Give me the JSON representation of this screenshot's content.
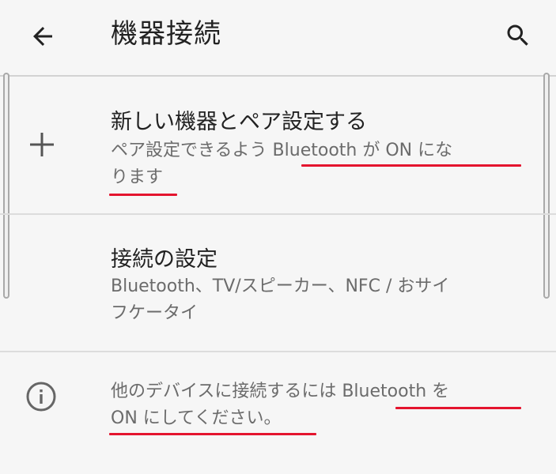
{
  "header": {
    "back_icon": "back-arrow-icon",
    "title": "機器接続",
    "search_icon": "search-icon"
  },
  "items": [
    {
      "icon": "plus-icon",
      "title": "新しい機器とペア設定する",
      "subtitle_line1": "ペア設定できるよう Bluetooth が ON にな",
      "subtitle_line2": "ります"
    },
    {
      "title": "接続の設定",
      "subtitle_line1": "Bluetooth、TV/スピーカー、NFC / おサイ",
      "subtitle_line2": "フケータイ"
    }
  ],
  "info": {
    "icon": "info-icon",
    "line1": "他のデバイスに接続するには Bluetooth を",
    "line2": "ON にしてください。"
  },
  "colors": {
    "background": "#f6f6f6",
    "annotation_underline": "#e4142e"
  }
}
